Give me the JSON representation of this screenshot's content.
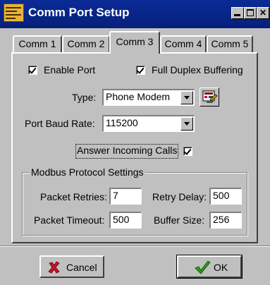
{
  "window": {
    "title": "Comm Port Setup"
  },
  "tabs": [
    {
      "label": "Comm 1"
    },
    {
      "label": "Comm 2"
    },
    {
      "label": "Comm 3"
    },
    {
      "label": "Comm 4"
    },
    {
      "label": "Comm 5"
    }
  ],
  "active_tab": "Comm 3",
  "enable_port": {
    "label": "Enable Port",
    "checked": true
  },
  "full_duplex": {
    "label": "Full Duplex Buffering",
    "checked": true
  },
  "type": {
    "label": "Type:",
    "value": "Phone Modem"
  },
  "baud": {
    "label": "Port Baud Rate:",
    "value": "115200"
  },
  "answer_calls": {
    "label": "Answer Incoming Calls",
    "checked": true
  },
  "modbus": {
    "group_label": "Modbus Protocol Settings",
    "packet_retries": {
      "label": "Packet Retries:",
      "value": "7"
    },
    "retry_delay": {
      "label": "Retry Delay:",
      "value": "500"
    },
    "packet_timeout": {
      "label": "Packet Timeout:",
      "value": "500"
    },
    "buffer_size": {
      "label": "Buffer Size:",
      "value": "256"
    }
  },
  "buttons": {
    "cancel": "Cancel",
    "ok": "OK"
  },
  "colors": {
    "titlebar": "#0a2b96",
    "face": "#c0c0c0",
    "cancel_icon": "#c8102e",
    "ok_icon": "#2f9a1c"
  },
  "icons": [
    "app-icon",
    "modem-settings-icon",
    "cancel-x-icon",
    "ok-check-icon",
    "minimize-icon",
    "maximize-icon",
    "close-icon"
  ]
}
